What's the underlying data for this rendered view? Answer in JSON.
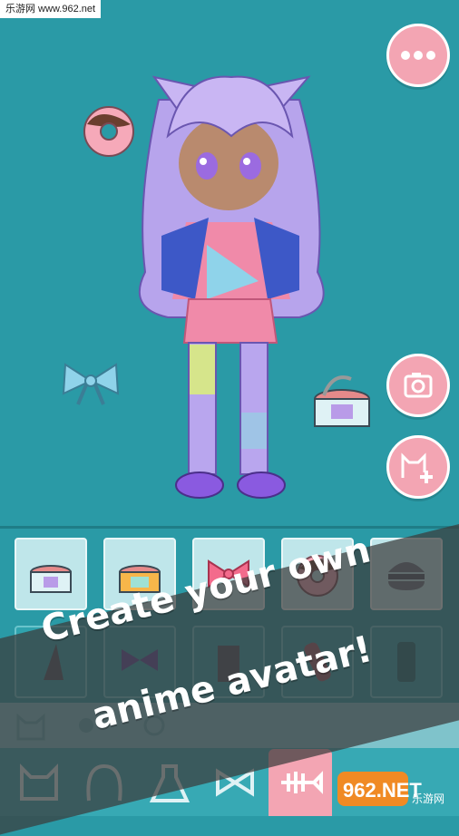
{
  "watermark": {
    "text": "乐游网 www.962.net"
  },
  "actions": {
    "more_icon": "ellipsis-icon",
    "camera_icon": "camera-icon",
    "add_avatar_icon": "cat-plus-icon"
  },
  "closet": {
    "row1": [
      {
        "name": "cat-food-can-icon"
      },
      {
        "name": "fish-can-icon"
      },
      {
        "name": "pink-bow-icon"
      },
      {
        "name": "chocolate-donut-icon"
      },
      {
        "name": "hamburger-icon"
      }
    ],
    "row2": [
      {
        "name": "shell-icon"
      },
      {
        "name": "purple-bow-icon"
      },
      {
        "name": "cup-icon"
      },
      {
        "name": "bandaid-icon"
      },
      {
        "name": "phone-case-icon"
      }
    ]
  },
  "tabs": [
    {
      "name": "cat-head-icon",
      "active": false
    },
    {
      "name": "hair-icon",
      "active": false
    },
    {
      "name": "dress-icon",
      "active": false
    },
    {
      "name": "bow-icon",
      "active": false
    },
    {
      "name": "fishbone-icon",
      "active": true
    }
  ],
  "banner": {
    "line1": "Create your own",
    "line2": "anime avatar!"
  },
  "logo": {
    "text": "962.NET",
    "subtext": "乐游网"
  },
  "colors": {
    "background": "#2a9aa6",
    "accent_pink": "#f3a5b3",
    "banner_gray": "#3c3c3c"
  }
}
